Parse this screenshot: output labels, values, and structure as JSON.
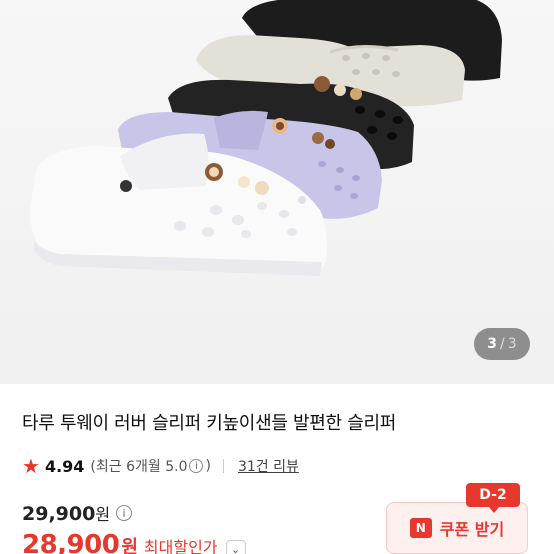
{
  "gallery": {
    "image_desc": "product-photo-clogs",
    "indicator_current": "3",
    "indicator_separator": "/",
    "indicator_total": "3"
  },
  "product": {
    "title": "타루 투웨이 러버 슬리퍼 키높이샌들 발편한 슬리퍼",
    "rating": "4.94",
    "recent_rating_prefix": "(최근 6개월 5.0",
    "recent_rating_suffix": ")",
    "review_count": "31건 리뷰",
    "original_price": "29,900",
    "original_price_unit": "원",
    "sale_price": "28,900",
    "sale_price_unit": "원",
    "max_discount_label": "최대할인가"
  },
  "coupon": {
    "badge": "D-2",
    "icon_text": "N",
    "label": "쿠폰 받기"
  },
  "colors": {
    "accent": "#e8372c",
    "coupon_bg": "#fff0f0"
  }
}
